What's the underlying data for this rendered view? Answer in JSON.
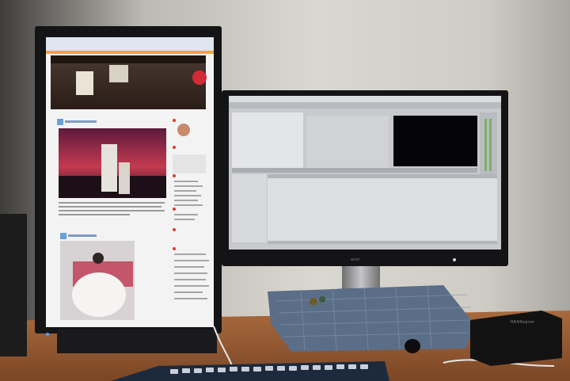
{
  "scene": {
    "monitor_right": {
      "brand": "acer"
    },
    "device": {
      "label": "HANNspree"
    }
  },
  "colors": {
    "wall": "#d9d6d0",
    "desk": "#9b5f36",
    "bezel": "#141416",
    "video_editor_bg": "#c7c9cc",
    "blog_header": "#3a2a22",
    "sunset": "#c43a50",
    "cloth": "#5a6e88"
  }
}
